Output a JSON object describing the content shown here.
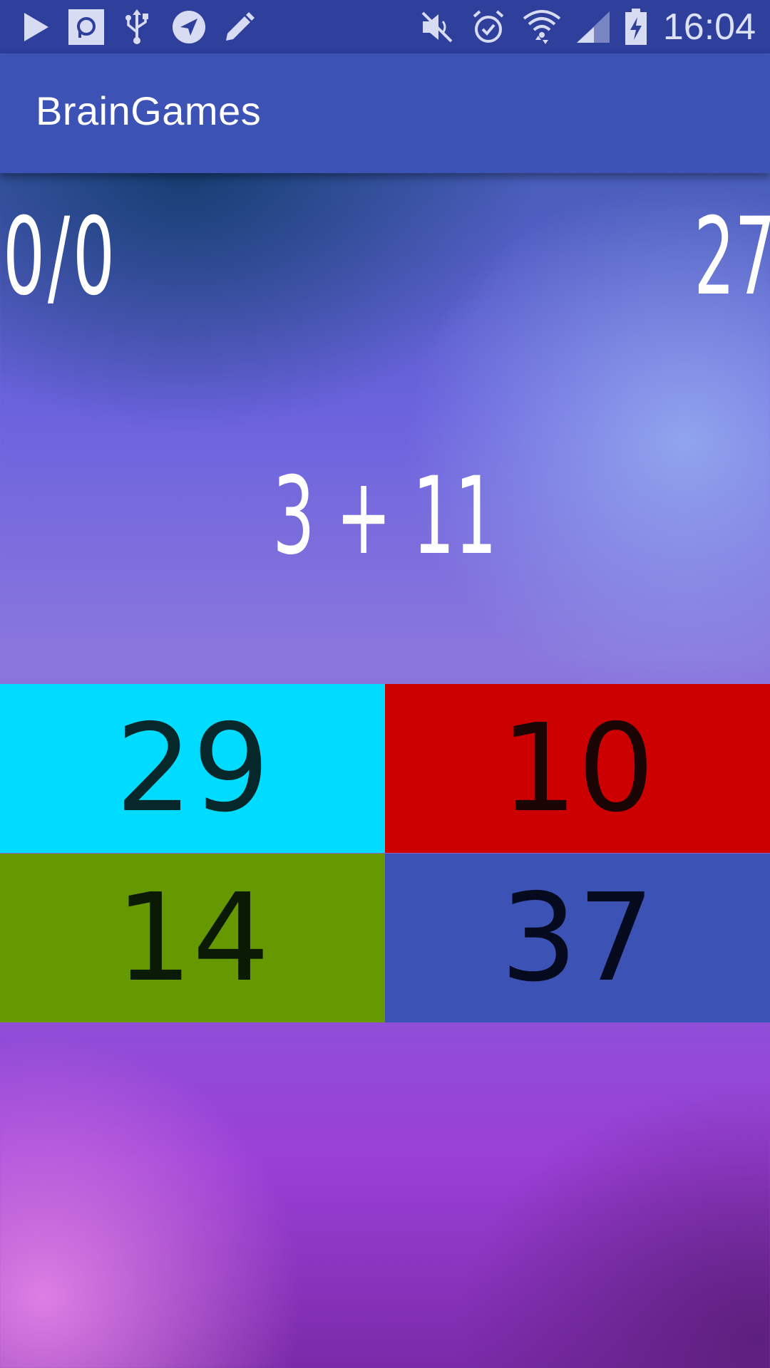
{
  "status_bar": {
    "time": "16:04",
    "left_icons": [
      "play-store-icon",
      "pocket-icon",
      "usb-icon",
      "location-arrow-icon",
      "pencil-icon"
    ],
    "right_icons": [
      "mute-icon",
      "alarm-icon",
      "wifi-icon",
      "signal-icon",
      "battery-charging-icon"
    ]
  },
  "app_bar": {
    "title": "BrainGames"
  },
  "game": {
    "score": "0/0",
    "timer": "27",
    "question": "3 + 11"
  },
  "answers": [
    "29",
    "10",
    "14",
    "37"
  ],
  "colors": {
    "status_bar": "#2e3f9c",
    "app_bar": "#3c52b4",
    "answer_0": "#00dcff",
    "answer_1": "#cc0000",
    "answer_2": "#669900",
    "answer_3": "#3c52b4"
  }
}
